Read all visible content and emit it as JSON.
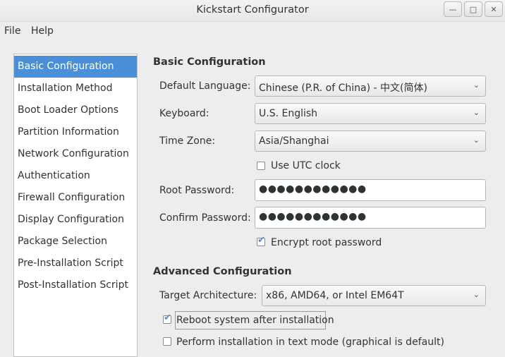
{
  "window": {
    "title": "Kickstart Configurator",
    "minimize_icon": "—",
    "maximize_icon": "□",
    "close_icon": "✕"
  },
  "menu": {
    "file": "File",
    "help": "Help"
  },
  "sidebar": {
    "items": [
      {
        "label": "Basic Configuration"
      },
      {
        "label": "Installation Method"
      },
      {
        "label": "Boot Loader Options"
      },
      {
        "label": "Partition Information"
      },
      {
        "label": "Network Configuration"
      },
      {
        "label": "Authentication"
      },
      {
        "label": "Firewall Configuration"
      },
      {
        "label": "Display Configuration"
      },
      {
        "label": "Package Selection"
      },
      {
        "label": "Pre-Installation Script"
      },
      {
        "label": "Post-Installation Script"
      }
    ],
    "selected_index": 0
  },
  "basic": {
    "heading": "Basic Configuration",
    "language_label": "Default Language:",
    "language_value": "Chinese (P.R. of China) - 中文(简体)",
    "keyboard_label": "Keyboard:",
    "keyboard_value": "U.S. English",
    "timezone_label": "Time Zone:",
    "timezone_value": "Asia/Shanghai",
    "utc_label": "Use UTC clock",
    "utc_checked": false,
    "root_pw_label": "Root Password:",
    "root_pw_value": "●●●●●●●●●●●●",
    "confirm_pw_label": "Confirm Password:",
    "confirm_pw_value": "●●●●●●●●●●●●",
    "encrypt_label": "Encrypt root password",
    "encrypt_checked": true
  },
  "advanced": {
    "heading": "Advanced Configuration",
    "arch_label": "Target Architecture:",
    "arch_value": "x86, AMD64, or Intel EM64T",
    "reboot_label": "Reboot system after installation",
    "reboot_checked": true,
    "textmode_label": "Perform installation in text mode (graphical is default)",
    "textmode_checked": false
  },
  "icons": {
    "dropdown": "⌄",
    "check": "✔"
  }
}
